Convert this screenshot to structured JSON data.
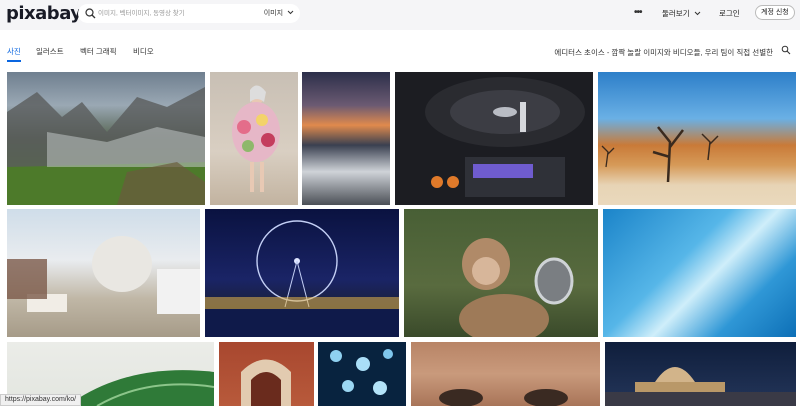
{
  "brand": {
    "logo": "pixabay"
  },
  "search": {
    "placeholder": "이미지, 벡터이미지, 동영상 찾기",
    "type_label": "이미지"
  },
  "header": {
    "more_label": "•••",
    "explore_label": "둘러보기",
    "login_label": "로그인",
    "join_label": "계정 신청"
  },
  "tabs": [
    {
      "label": "사진",
      "active": true
    },
    {
      "label": "일러스트",
      "active": false
    },
    {
      "label": "벡터 그래픽",
      "active": false
    },
    {
      "label": "비디오",
      "active": false
    }
  ],
  "promo_text": "에디터스 초이스 - 깜짝 놀랄 이미지와 비디오들, 우리 팀이 직접 선별한",
  "status_url": "https://pixabay.com/ko/",
  "colors": {
    "accent": "#0a66e0",
    "header_bg": "#f5f5f7"
  },
  "icons": {
    "search": "search-icon",
    "chevron": "chevron-down-icon",
    "dots": "more-icon"
  }
}
